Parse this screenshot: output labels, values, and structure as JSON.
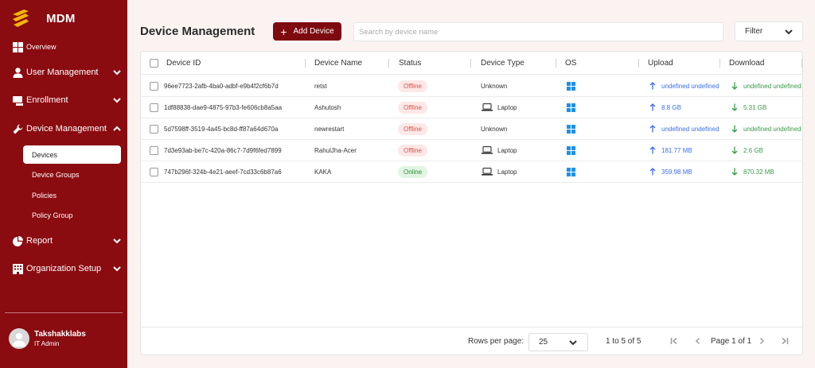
{
  "app": {
    "name": "MDM"
  },
  "sidebar": {
    "items": [
      {
        "label": "Overview",
        "icon": "grid-icon"
      },
      {
        "label": "User Management",
        "icon": "user-icon"
      },
      {
        "label": "Enrollment",
        "icon": "enrollment-icon"
      },
      {
        "label": "Device Management",
        "icon": "wrench-icon"
      },
      {
        "label": "Report",
        "icon": "pie-chart-icon"
      },
      {
        "label": "Organization Setup",
        "icon": "building-icon"
      }
    ],
    "sub_items": [
      "Devices",
      "Device Groups",
      "Policies",
      "Policy Group"
    ],
    "active_sub_item": "Devices"
  },
  "user": {
    "name": "Takshakklabs",
    "role": "IT Admin"
  },
  "header": {
    "title": "Device Management",
    "add_button": "Add Device",
    "search_placeholder": "Search by device name",
    "filter_label": "Filter"
  },
  "table": {
    "columns": [
      "Device ID",
      "Device Name",
      "Status",
      "Device Type",
      "OS",
      "Upload",
      "Download"
    ],
    "rows": [
      {
        "device_id": "96ee7723-2afb-4ba0-adbf-e9b4f2cf6b7d",
        "name": "retst",
        "status": "Offline",
        "type": "Unknown",
        "os": "windows-icon",
        "upload": "undefined undefined",
        "download": "undefined undefined"
      },
      {
        "device_id": "1df88838-dae9-4875-97b3-fe606cb8a5aa",
        "name": "Ashutosh",
        "status": "Offline",
        "type": "Laptop",
        "os": "windows-icon",
        "upload": "8.8 GB",
        "download": "5.31 GB"
      },
      {
        "device_id": "5d7598ff-3519-4a45-bc8d-ff87a64d670a",
        "name": "newrestart",
        "status": "Offline",
        "type": "Unknown",
        "os": "windows-icon",
        "upload": "undefined undefined",
        "download": "undefined undefined"
      },
      {
        "device_id": "7d3e93ab-be7c-420a-86c7-7d9f6fed7899",
        "name": "RahulJha-Acer",
        "status": "Offline",
        "type": "Laptop",
        "os": "windows-icon",
        "upload": "181.77 MB",
        "download": "2.6 GB"
      },
      {
        "device_id": "747b296f-324b-4e21-aeef-7cd33c6b87a6",
        "name": "KAKA",
        "status": "Online",
        "type": "Laptop",
        "os": "windows-icon",
        "upload": "359.98 MB",
        "download": "870.32 MB"
      }
    ]
  },
  "pagination": {
    "rows_per_page_label": "Rows per page:",
    "rows_per_page": "25",
    "range": "1 to 5 of 5",
    "page_label": "Page 1 of 1"
  },
  "colors": {
    "sidebar_bg": "#8a0b10",
    "primary": "#7d0a0f",
    "offline": "#d9534f",
    "online": "#2e8b3a",
    "upload": "#3b6ef0",
    "download": "#3a9a4a",
    "windows": "#1e90e8"
  }
}
